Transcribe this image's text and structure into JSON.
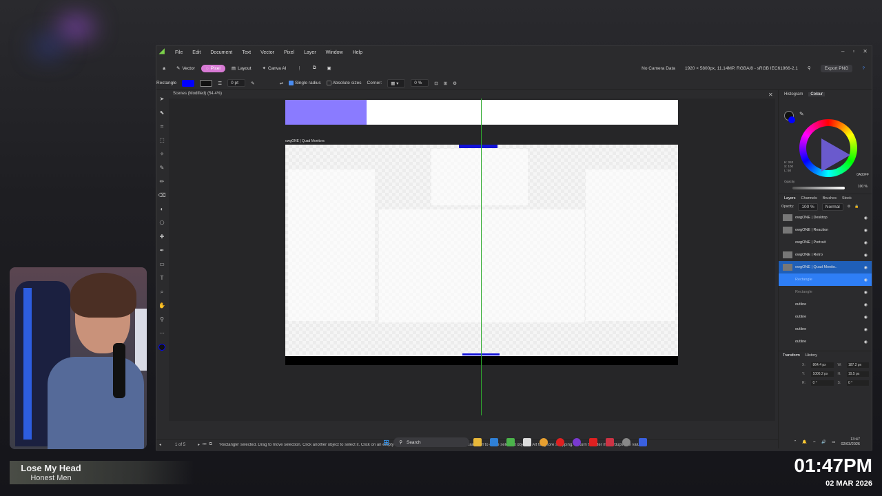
{
  "menu": [
    "File",
    "Edit",
    "Document",
    "Text",
    "Vector",
    "Pixel",
    "Layer",
    "Window",
    "Help"
  ],
  "personas": {
    "vector": "Vector",
    "pixel": "Pixel",
    "layout": "Layout",
    "canva": "Canva AI"
  },
  "toolbar_right": {
    "camera": "No Camera Data",
    "doc_info": "1920 × 5800px, 11.14MP, RGBA/8 - sRGB IEC61966-2.1",
    "export": "Export PNG"
  },
  "context": {
    "tool": "Rectangle",
    "stroke_width": "0 pt",
    "single_radius": "Single radius",
    "absolute_sizes": "Absolute sizes",
    "corner": "Corner:",
    "corner_pct": "0 %"
  },
  "colors": {
    "fill": "#0000ff",
    "stroke": "#111111",
    "accent": "#d77ad4"
  },
  "doc_tab": "Scenes (Modified) (54.4%)",
  "artboard2_label": "owgONE | Quad Monitors",
  "status": {
    "page": "1 of 5",
    "hint": "'Rectangle' selected. Drag to move selection. Click another object to select it. Click on an empty area to deselect selection. Shift to constrain. Ctrl to clone selected objects. Alt to ignore snapping. Return to enter move/duplicate values."
  },
  "colour_panel": {
    "tab1": "Histogram",
    "tab2": "Colour",
    "hsl": [
      "H: 242",
      "S: 100",
      "L: 50"
    ],
    "hex": "0A00FF",
    "opacity_label": "Opacity",
    "opacity_value": "100 %"
  },
  "layers_panel": {
    "tabs": [
      "Layers",
      "Channels",
      "Brushes",
      "Stock"
    ],
    "opacity": "100 %",
    "blend": "Normal",
    "items": [
      {
        "name": "owgONE | Desktop"
      },
      {
        "name": "owgONE | Reaction"
      },
      {
        "name": "owgONE | Portrait"
      },
      {
        "name": "owgONE | Retro"
      },
      {
        "name": "owgONE | Quad Monito.."
      },
      {
        "name": "Rectangle"
      },
      {
        "name": "Rectangle"
      },
      {
        "name": "outline"
      },
      {
        "name": "outline"
      },
      {
        "name": "outline"
      },
      {
        "name": "outline"
      }
    ]
  },
  "transform": {
    "tab1": "Transform",
    "tab2": "History",
    "x": "864.4 px",
    "y": "1006.2 px",
    "w": "187.2 px",
    "h": "19.5 px",
    "r": "0 °",
    "s": "0 °"
  },
  "taskbar": {
    "search": "Search",
    "time": "13:47",
    "date": "02/03/2026"
  },
  "now_playing": {
    "title": "Lose My Head",
    "artist": "Honest Men"
  },
  "overlay_clock": {
    "time": "01:47PM",
    "date": "02 MAR 2026"
  }
}
